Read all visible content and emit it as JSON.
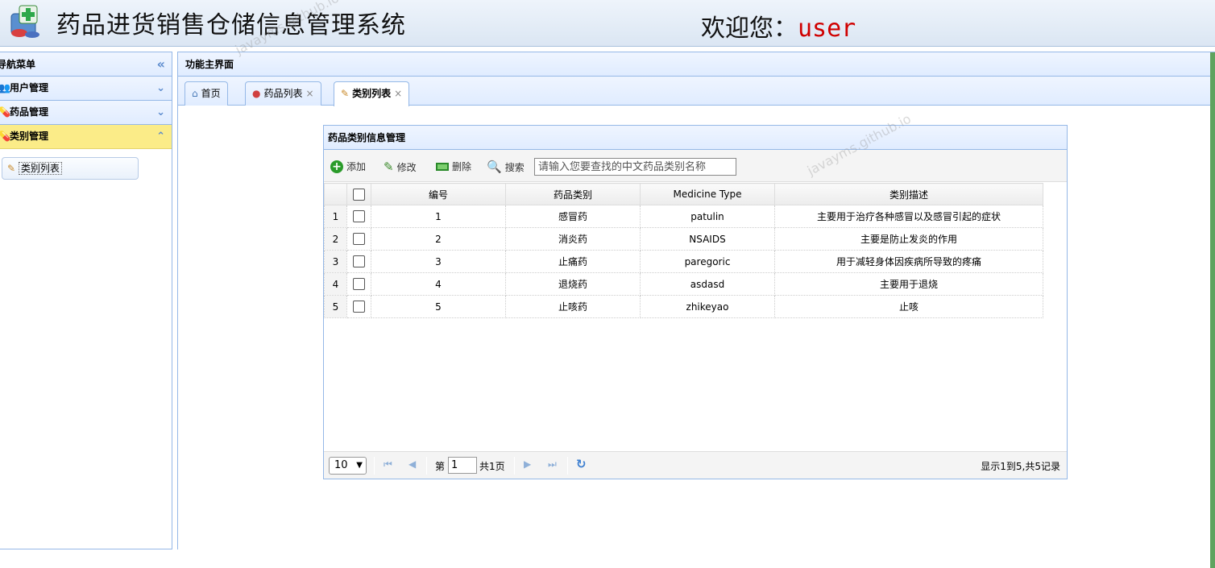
{
  "header": {
    "title": "药品进货销售仓储信息管理系统",
    "welcome_label": "欢迎您：",
    "username": "user"
  },
  "nav": {
    "title": "导航菜单",
    "collapse_icon": "double-chevron-left-icon",
    "sections": [
      {
        "label": "用户管理",
        "icon": "users-icon",
        "expanded": false
      },
      {
        "label": "药品管理",
        "icon": "pill-icon",
        "expanded": false
      },
      {
        "label": "类别管理",
        "icon": "capsule-icon",
        "expanded": true
      }
    ],
    "items": [
      {
        "label": "类别列表",
        "icon": "edit-note-icon"
      }
    ]
  },
  "main": {
    "title": "功能主界面",
    "tabs": [
      {
        "label": "首页",
        "icon": "home-icon",
        "closable": false,
        "active": false
      },
      {
        "label": "药品列表",
        "icon": "pills-icon",
        "closable": true,
        "active": false
      },
      {
        "label": "类别列表",
        "icon": "edit-note-icon",
        "closable": true,
        "active": true
      }
    ]
  },
  "grid": {
    "title": "药品类别信息管理",
    "toolbar": {
      "add": "添加",
      "edit": "修改",
      "delete": "删除",
      "search": "搜索",
      "search_placeholder": "请输入您要查找的中文药品类别名称"
    },
    "columns": [
      "编号",
      "药品类别",
      "Medicine Type",
      "类别描述"
    ],
    "rows": [
      {
        "rownum": "1",
        "id": "1",
        "category": "感冒药",
        "type": "patulin",
        "desc": "主要用于治疗各种感冒以及感冒引起的症状"
      },
      {
        "rownum": "2",
        "id": "2",
        "category": "消炎药",
        "type": "NSAIDS",
        "desc": "主要是防止发炎的作用"
      },
      {
        "rownum": "3",
        "id": "3",
        "category": "止痛药",
        "type": "paregoric",
        "desc": "用于减轻身体因疾病所导致的疼痛"
      },
      {
        "rownum": "4",
        "id": "4",
        "category": "退烧药",
        "type": "asdasd",
        "desc": "主要用于退烧"
      },
      {
        "rownum": "5",
        "id": "5",
        "category": "止咳药",
        "type": "zhikeyao",
        "desc": "止咳"
      }
    ],
    "pager": {
      "page_size": "10",
      "page_prefix": "第",
      "page_value": "1",
      "page_total": "共1页",
      "info": "显示1到5,共5记录"
    }
  },
  "watermark": "javayms.github.io",
  "colors": {
    "accent_border": "#95b8e7",
    "selected_section": "#fbec88",
    "username": "#d00000"
  }
}
